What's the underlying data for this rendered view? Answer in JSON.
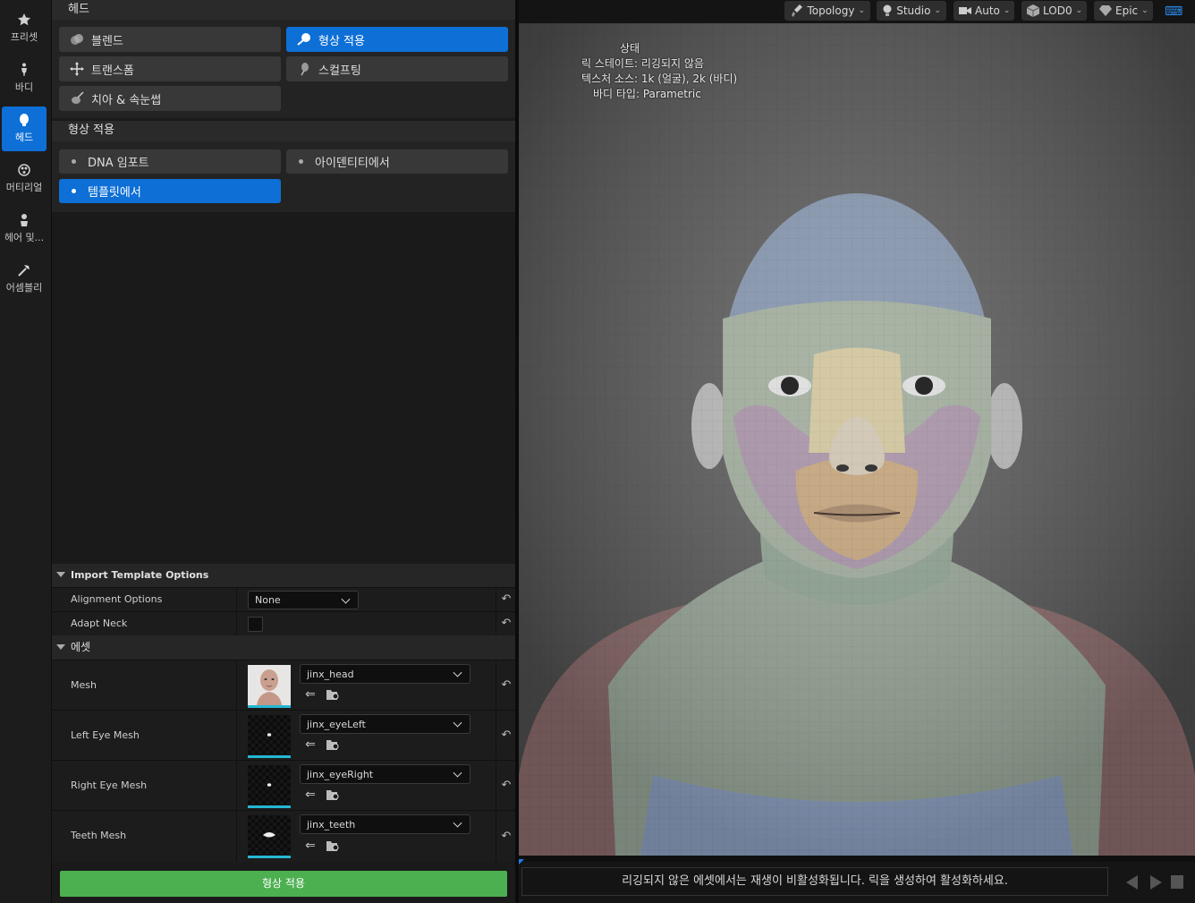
{
  "rail": {
    "items": [
      {
        "label": "프리셋",
        "icon": "star-icon"
      },
      {
        "label": "바디",
        "icon": "body-icon"
      },
      {
        "label": "헤드",
        "icon": "head-icon",
        "active": true
      },
      {
        "label": "머티리얼",
        "icon": "material-icon"
      },
      {
        "label": "헤어 및...",
        "icon": "hair-icon"
      },
      {
        "label": "어셈블리",
        "icon": "hammer-icon"
      }
    ]
  },
  "head_section": {
    "title": "헤드",
    "buttons": [
      {
        "label": "블렌드",
        "icon": "blend-icon"
      },
      {
        "label": "형상 적용",
        "icon": "conform-icon",
        "selected": true
      },
      {
        "label": "트랜스폼",
        "icon": "transform-icon"
      },
      {
        "label": "스컬프팅",
        "icon": "sculpt-icon"
      },
      {
        "label": "치아 & 속눈썹",
        "icon": "teeth-icon"
      }
    ]
  },
  "conform_section": {
    "title": "형상 적용",
    "options": [
      {
        "label": "DNA 임포트"
      },
      {
        "label": "아이덴티티에서"
      },
      {
        "label": "템플릿에서",
        "selected": true
      }
    ]
  },
  "import_options": {
    "title": "Import Template Options",
    "alignment_label": "Alignment Options",
    "alignment_value": "None",
    "adapt_neck_label": "Adapt Neck"
  },
  "assets": {
    "title": "에셋",
    "rows": [
      {
        "label": "Mesh",
        "value": "jinx_head"
      },
      {
        "label": "Left Eye Mesh",
        "value": "jinx_eyeLeft"
      },
      {
        "label": "Right Eye Mesh",
        "value": "jinx_eyeRight"
      },
      {
        "label": "Teeth Mesh",
        "value": "jinx_teeth"
      }
    ]
  },
  "apply_button": "형상 적용",
  "toolbar": {
    "items": [
      {
        "label": "Topology",
        "icon": "brush-icon"
      },
      {
        "label": "Studio",
        "icon": "light-icon"
      },
      {
        "label": "Auto",
        "icon": "camera-icon"
      },
      {
        "label": "LOD0",
        "icon": "cube-icon"
      },
      {
        "label": "Epic",
        "icon": "quality-icon"
      }
    ]
  },
  "status": {
    "title": "상태",
    "rig_state": "릭 스테이트: 리깅되지 않음",
    "texture_source": "텍스처 소스: 1k (얼굴), 2k (바디)",
    "body_type": "바디 타입: Parametric"
  },
  "message": "리깅되지 않은 에셋에서는 재생이 비활성화됩니다. 릭을 생성하여 활성화하세요.",
  "colors": {
    "accent": "#0e6fd6",
    "apply_green": "#4caf50",
    "thumb_underline": "#25b7d3"
  }
}
